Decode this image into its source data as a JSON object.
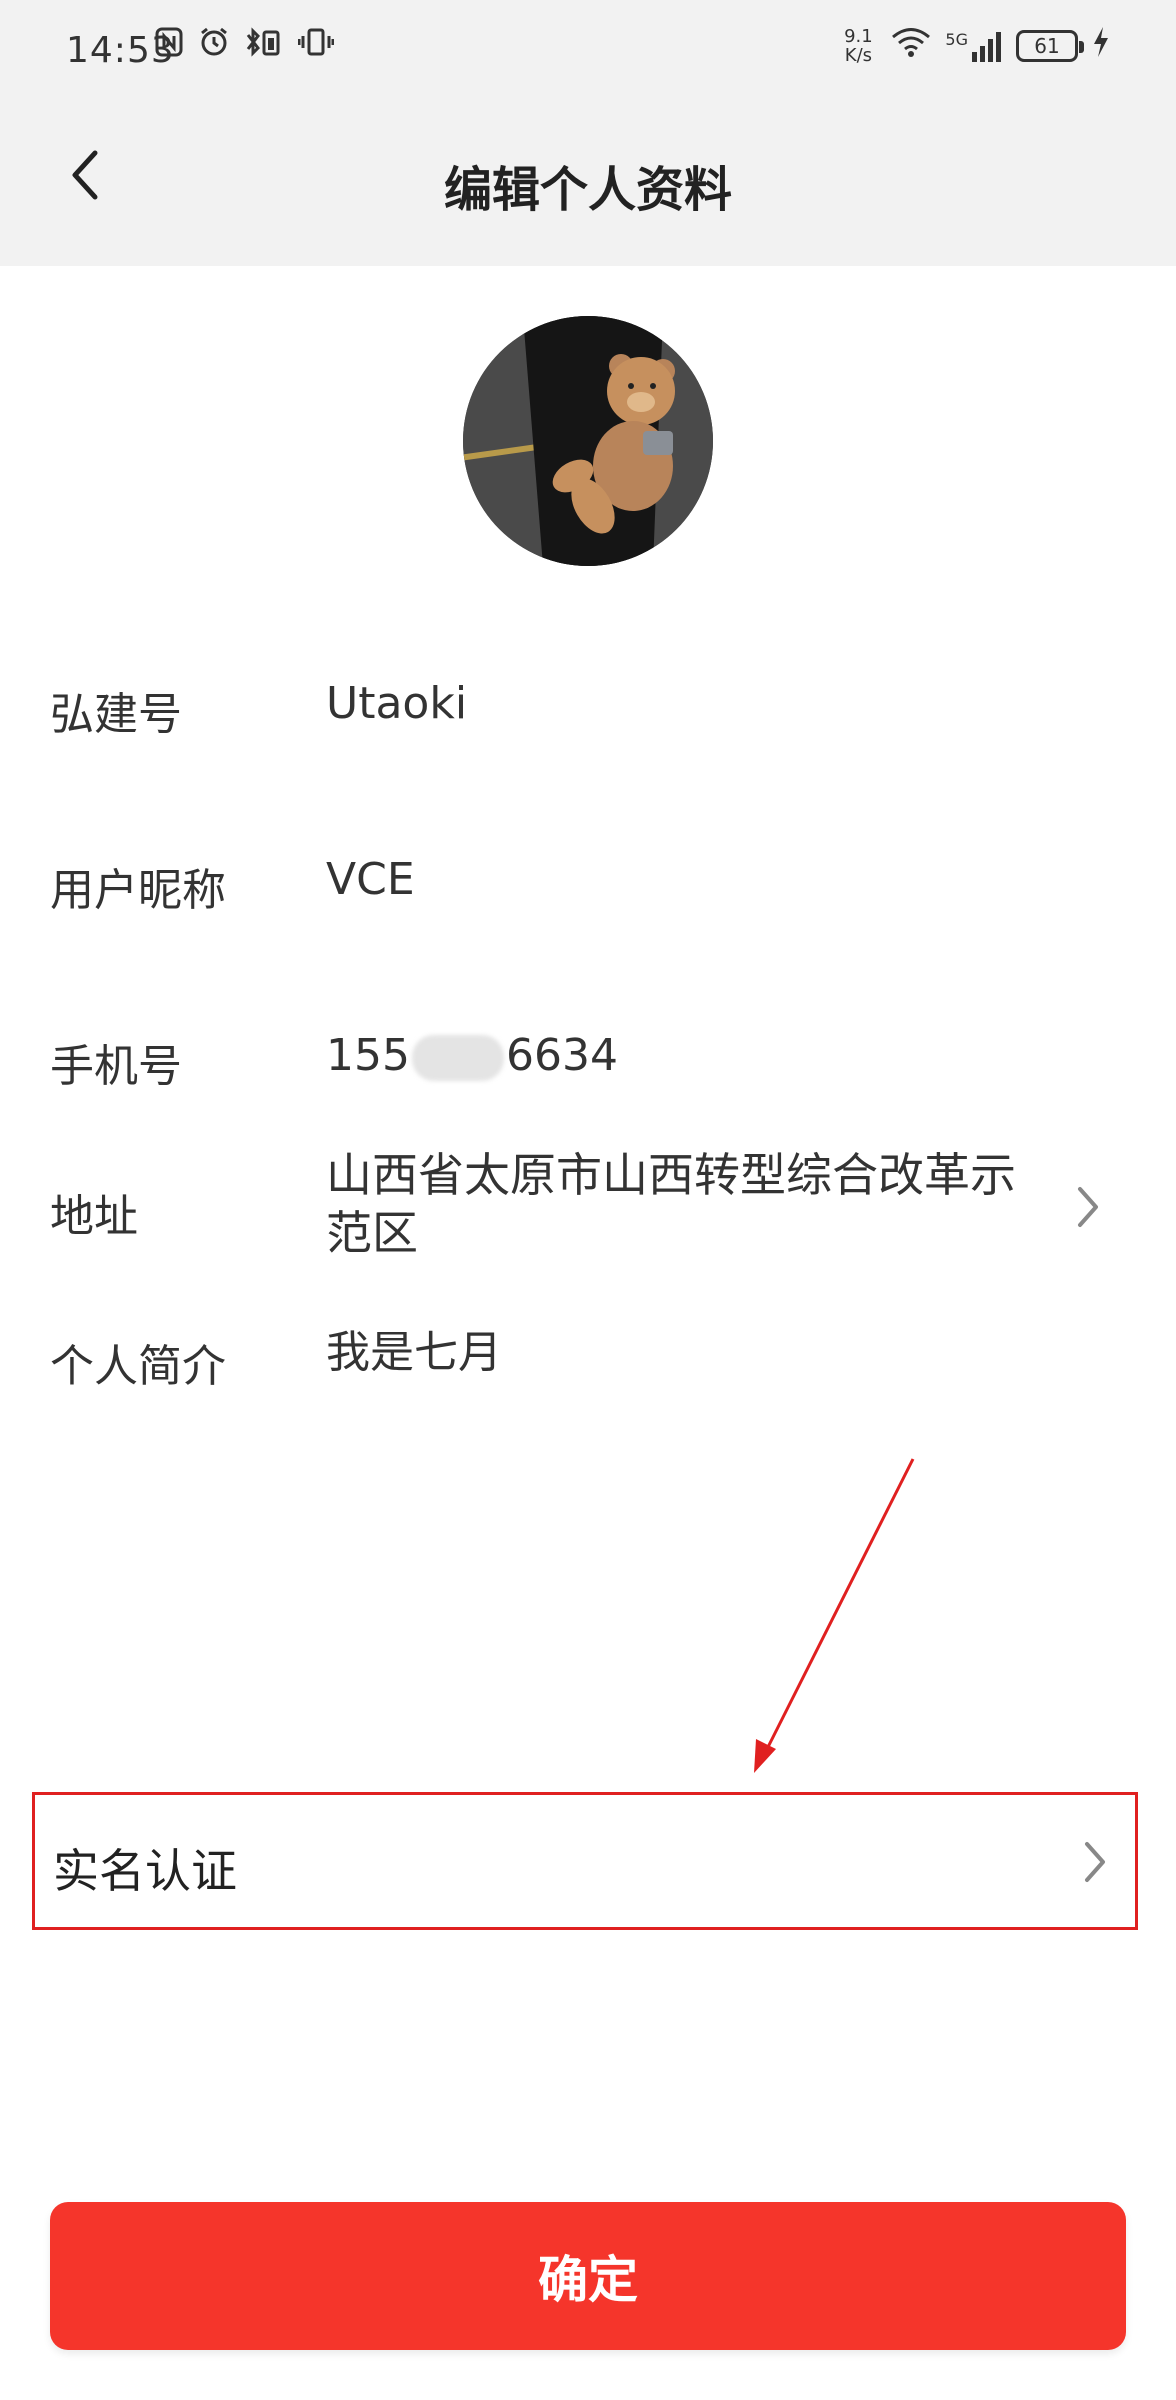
{
  "status_bar": {
    "time": "14:53",
    "net_speed": "9.1 K/s",
    "network": "5G",
    "battery": "61",
    "icons_left": [
      "nfc-icon",
      "alarm-icon",
      "bluetooth-battery-icon",
      "vibrate-icon"
    ],
    "icons_right": [
      "wifi-icon",
      "signal-icon",
      "battery-icon",
      "charging-icon"
    ]
  },
  "header": {
    "title": "编辑个人资料",
    "back_icon": "back-chevron-icon"
  },
  "profile": {
    "fields": [
      {
        "label": "弘建号",
        "value": "Utaoki"
      },
      {
        "label": "用户昵称",
        "value": "VCE"
      },
      {
        "label": "手机号",
        "value_prefix": "155",
        "value_suffix": "6634"
      },
      {
        "label": "地址",
        "value": "山西省太原市山西转型综合改革示范区"
      },
      {
        "label": "个人简介",
        "value": "我是七月"
      }
    ]
  },
  "verification": {
    "label": "实名认证"
  },
  "actions": {
    "confirm_label": "确定"
  },
  "colors": {
    "accent": "#f5352b",
    "annotation": "#e02020",
    "header_bg": "#f2f2f2"
  }
}
